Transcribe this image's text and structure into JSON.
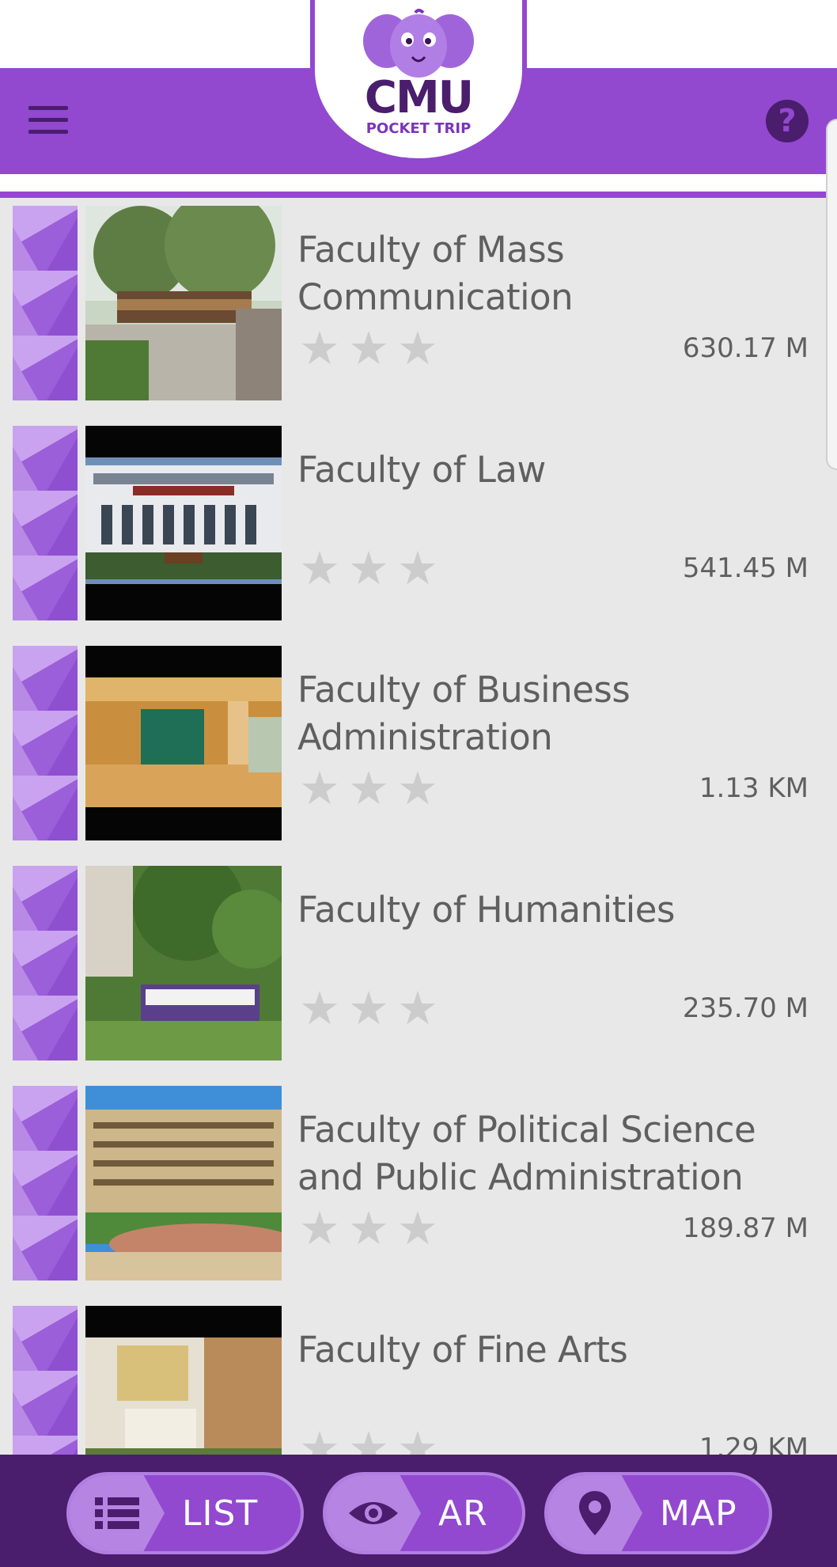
{
  "header": {
    "logo_title": "CMU",
    "logo_subtitle": "POCKET TRIP",
    "menu_icon": "hamburger-menu-icon",
    "help_icon": "question-mark-icon",
    "help_glyph": "?"
  },
  "colors": {
    "brand_purple": "#9248cf",
    "dark_purple": "#4a1d6d",
    "text_gray": "#5f5f5f",
    "star_gray": "#cccccc",
    "list_background": "#e8e8e8"
  },
  "places": [
    {
      "title": "Faculty of Mass Communication",
      "distance": "630.17 M",
      "stars": 3,
      "rating": 0
    },
    {
      "title": "Faculty of Law",
      "distance": "541.45 M",
      "stars": 3,
      "rating": 0
    },
    {
      "title": "Faculty of Business Administration",
      "distance": "1.13 KM",
      "stars": 3,
      "rating": 0
    },
    {
      "title": "Faculty of Humanities",
      "distance": "235.70 M",
      "stars": 3,
      "rating": 0
    },
    {
      "title": "Faculty of Political Science and Public Administration",
      "distance": "189.87 M",
      "stars": 3,
      "rating": 0
    },
    {
      "title": "Faculty of Fine Arts",
      "distance": "1.29 KM",
      "stars": 3,
      "rating": 0
    }
  ],
  "bottom_nav": {
    "list_label": "LIST",
    "ar_label": "AR",
    "map_label": "MAP",
    "list_icon": "list-icon",
    "ar_icon": "eye-icon",
    "map_icon": "map-pin-icon"
  }
}
